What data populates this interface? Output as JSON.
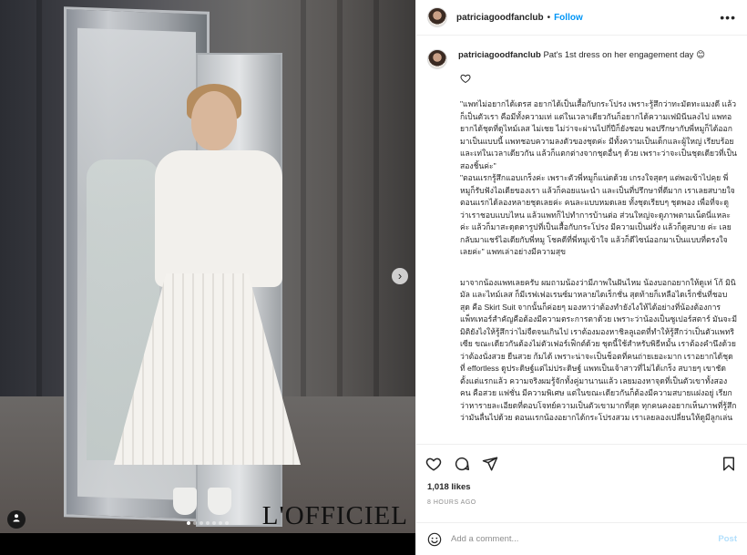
{
  "post": {
    "username": "patriciagoodfanclub",
    "follow_label": "Follow",
    "separator": "•",
    "more_label": "•••",
    "watermark": "L'OFFICIEL",
    "carousel": {
      "total": 7,
      "active_index": 0
    }
  },
  "caption": {
    "username": "patriciagoodfanclub",
    "text": "Pat's 1st dress on her engagement day 😊",
    "paragraph1": "\"แพทไม่อยากได้เดรส อยากได้เป็นเสื้อกับกระโปรง เพราะรู้สึกว่าทะมัดทะแมงดี แล้วก็เป็นตัวเรา คือมีทั้งความเท่ แต่ในเวลาเดียวกันก็อยากได้ความเฟมินีนลงไป แพทอยากได้ชุดที่ดูไทม์เลส ไม่เชย ไม่ว่าจะผ่านไปกี่ปีก็ยังชอบ พอปรึกษากับพี่หมูก็ได้ออกมาเป็นแบบนี้ แพทชอบความลงตัวของชุดค่ะ มีทั้งความเป็นเด็กและผู้ใหญ่ เรียบร้อยและเท่ในเวลาเดียวกัน แล้วก็แตกต่างจากชุดอื่นๆ ด้วย เพราะว่าจะเป็นชุดเดียวที่เป็นสองชิ้นค่ะ\"\n\"ตอนแรกรู้สึกแอบเกร็งค่ะ เพราะตัวพี่หมูก็แน่ดด้วย เกรงใจสุดๆ แต่พอเข้าไปคุย พี่หมูก็รับฟังไอเดียของเรา แล้วก็คอยแนะนำ และเป็นที่ปรึกษาที่ดีมาก เราเลยสบายใจ ตอนแรกได้ลองหลายชุดเลยค่ะ คนละแบบหมดเลย ทั้งชุดเรียบๆ ชุดพอง เพื่อที่จะดูว่าเราชอบแบบไหน แล้วแพทก็ไปทำการบ้านต่อ ส่วนใหญ่จะดูภาพตามเน็ตนี่แหละค่ะ แล้วก็มาสะดุดตารูปที่เป็นเสื้อกับกระโปรง มีความเป็นฝรั่ง แล้วก็ดูสบาย ค่ะ เลยกลับมาแชร์ไอเดียกับพี่หมู โชคดีที่พี่หมูเข้าใจ แล้วก็ดีไซน์ออกมาเป็นแบบที่ตรงใจเลยค่ะ\" แพทเล่าอย่างมีความสุข",
    "paragraph2": "มาจากน้องแพทเลยครับ ผมถามน้องว่ามีภาพในฝันไหม น้องบอกอยากให้ดูเท่ โก้ มินิมัล และไทม์เลส ก็มีเรฟเฟอเรนซ์มาหลายไดเร็กชั่น สุดท้ายก็เหลือไดเร็กชั่นที่ชอบสุด คือ Skirt Suit จากนั้นก็ค่อยๆ มองหาว่าต้องทำยังไงให้ได้อย่างที่น้องต้องการ แพ็ทเทอร์สำคัญคือต้องมีความตระการตาด้วย เพราะว่าน้องเป็นซูเปอร์สตาร์ มันจะมีมิติยังไงให้รู้สึกว่าไม่จืดจนเกินไป เราต้องมองหาชิลลูเอตที่ทำให้รู้สึกว่าเป็นตัวแพทริเซีย ขณะเดียวกันต้องไม่ตัวเฟอร์เฟ็กต์ด้วย ชุดนี้ใช้สำหรับพิธีหมั้น เราต้องคำนึงด้วยว่าต้องนั่งสวย ยืนสวย ก้มได้ เพราะน่าจะเป็นช็อตที่คนถ่ายเยอะมาก เราอยากได้ชุดที่ effortless ดูประดิษฐ์แต่ไม่ประดิษฐ์ แพทเป็นเจ้าสาวที่ไม่ได้เกร็ง สบายๆ เขาชัดตั้งแต่แรกแล้ว ความจริงผมรู้จักทั้งคู่มานานแล้ว เลยมองหาจุดที่เป็นตัวเขาทั้งสองคน คือสวย แฟชั่น มีความพิเศษ แต่ในขณะเดียวกันก็ต้องมีความสบายแฝงอยู่ เรียกว่าหารายละเอียดที่ตอบโจทย์ความเป็นตัวเขามากที่สุด ทุกคนคงอยากเห็นภาพที่รู้สึกว่ามันลื่นไปด้วย ตอนแรกน้องอยากได้กระโปรงสวม เราเลยลองเปลี่ยนให้ดูมีลูกเล่น"
  },
  "footer": {
    "likes": "1,018 likes",
    "time": "8 HOURS AGO",
    "comment_placeholder": "Add a comment...",
    "post_label": "Post"
  },
  "icons": {
    "like": "heart-icon",
    "comment": "comment-icon",
    "share": "share-icon",
    "save": "bookmark-icon",
    "emoji": "emoji-icon",
    "carousel_next": "chevron-right-icon",
    "tag": "person-tag-icon"
  },
  "colors": {
    "accent": "#0095f6",
    "muted": "#8e8e8e",
    "post_disabled": "#b2dffc",
    "border": "#efefef"
  }
}
